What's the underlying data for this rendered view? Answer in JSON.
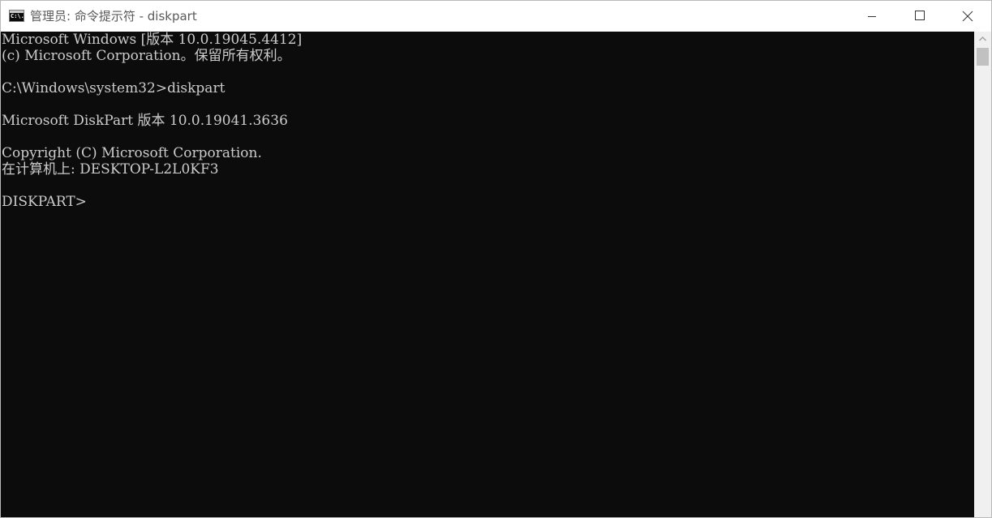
{
  "window": {
    "title": "管理员: 命令提示符 - diskpart",
    "icon_label": "C:\\.",
    "icon": "console-app-icon"
  },
  "controls": {
    "minimize": "minimize-icon",
    "maximize": "maximize-icon",
    "close": "close-icon"
  },
  "console": {
    "lines": [
      "Microsoft Windows [版本 10.0.19045.4412]",
      "(c) Microsoft Corporation。保留所有权利。",
      "",
      "C:\\Windows\\system32>diskpart",
      "",
      "Microsoft DiskPart 版本 10.0.19041.3636",
      "",
      "Copyright (C) Microsoft Corporation.",
      "在计算机上: DESKTOP-L2L0KF3",
      "",
      "DISKPART>"
    ]
  },
  "colors": {
    "console_bg": "#0c0c0c",
    "console_fg": "#cccccc",
    "titlebar_bg": "#ffffff",
    "title_fg": "#5a5a5a",
    "scrollbar_bg": "#f0f0f0",
    "scrollbar_thumb": "#c1c1c1"
  }
}
